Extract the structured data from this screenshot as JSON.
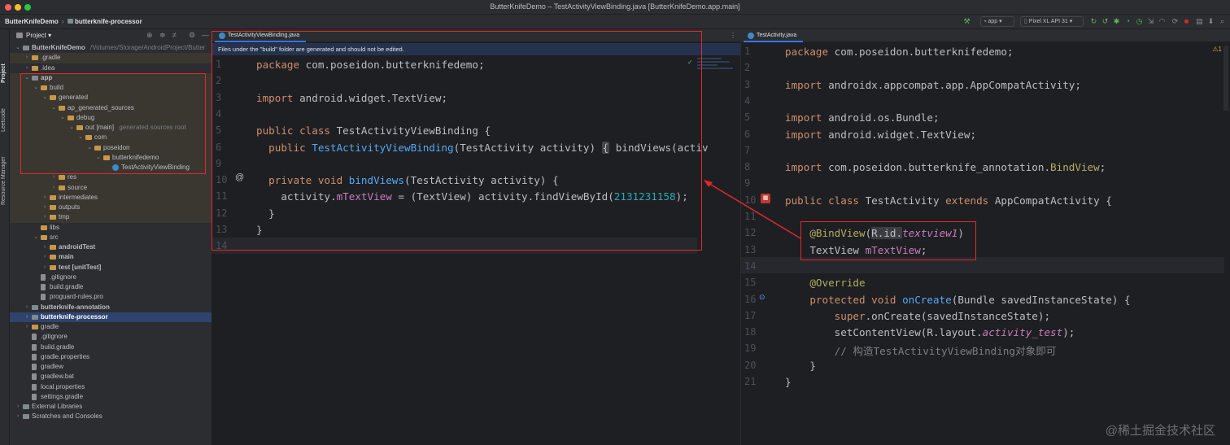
{
  "window": {
    "title": "ButterKnifeDemo – TestActivityViewBinding.java [ButterKnifeDemo.app.main]"
  },
  "navbar": {
    "project": "ButterKnifeDemo",
    "module": "butterknife-processor",
    "run_config": "app",
    "device": "Pixel XL API 31"
  },
  "toolstrip": {
    "items": [
      "Project",
      "Leetcode",
      "Resource Manager"
    ]
  },
  "project_panel": {
    "title": "Project",
    "tree": [
      {
        "label": "ButterKnifeDemo",
        "suffix": "/Volumes/Storage/AndroidProject/Butter",
        "depth": 0,
        "arrow": "down",
        "icon": "folder-dark",
        "bold": true
      },
      {
        "label": ".gradle",
        "depth": 1,
        "arrow": "right",
        "icon": "folder",
        "gen": true
      },
      {
        "label": ".idea",
        "depth": 1,
        "arrow": "right",
        "icon": "folder"
      },
      {
        "label": "app",
        "depth": 1,
        "arrow": "down",
        "icon": "folder-dark",
        "bold": true,
        "gen": true
      },
      {
        "label": "build",
        "depth": 2,
        "arrow": "down",
        "icon": "folder",
        "gen": true
      },
      {
        "label": "generated",
        "depth": 3,
        "arrow": "down",
        "icon": "folder",
        "gen": true
      },
      {
        "label": "ap_generated_sources",
        "depth": 4,
        "arrow": "down",
        "icon": "folder",
        "gen": true
      },
      {
        "label": "debug",
        "depth": 5,
        "arrow": "down",
        "icon": "folder",
        "gen": true
      },
      {
        "label": "out [main]",
        "suffix": "generated sources root",
        "depth": 6,
        "arrow": "down",
        "icon": "folder",
        "gen": true
      },
      {
        "label": "com",
        "depth": 7,
        "arrow": "down",
        "icon": "folder",
        "gen": true
      },
      {
        "label": "poseidon",
        "depth": 8,
        "arrow": "down",
        "icon": "folder",
        "gen": true
      },
      {
        "label": "butterknifedemo",
        "depth": 9,
        "arrow": "down",
        "icon": "folder",
        "gen": true
      },
      {
        "label": "TestActivityViewBinding",
        "depth": 10,
        "arrow": "",
        "icon": "class",
        "gen": true
      },
      {
        "label": "res",
        "depth": 4,
        "arrow": "right",
        "icon": "folder",
        "gen": true
      },
      {
        "label": "source",
        "depth": 4,
        "arrow": "right",
        "icon": "folder",
        "gen": true
      },
      {
        "label": "intermediates",
        "depth": 3,
        "arrow": "right",
        "icon": "folder",
        "gen": true
      },
      {
        "label": "outputs",
        "depth": 3,
        "arrow": "right",
        "icon": "folder",
        "gen": true
      },
      {
        "label": "tmp",
        "depth": 3,
        "arrow": "right",
        "icon": "folder",
        "gen": true
      },
      {
        "label": "libs",
        "depth": 2,
        "arrow": "",
        "icon": "folder"
      },
      {
        "label": "src",
        "depth": 2,
        "arrow": "down",
        "icon": "folder"
      },
      {
        "label": "androidTest",
        "depth": 3,
        "arrow": "right",
        "icon": "folder",
        "bold": true
      },
      {
        "label": "main",
        "depth": 3,
        "arrow": "right",
        "icon": "folder",
        "bold": true
      },
      {
        "label": "test [unitTest]",
        "depth": 3,
        "arrow": "right",
        "icon": "folder",
        "bold": true
      },
      {
        "label": ".gitignore",
        "depth": 2,
        "arrow": "",
        "icon": "file"
      },
      {
        "label": "build.gradle",
        "depth": 2,
        "arrow": "",
        "icon": "file"
      },
      {
        "label": "proguard-rules.pro",
        "depth": 2,
        "arrow": "",
        "icon": "file"
      },
      {
        "label": "butterknife-annotation",
        "depth": 1,
        "arrow": "right",
        "icon": "folder-dark",
        "bold": true
      },
      {
        "label": "butterknife-processor",
        "depth": 1,
        "arrow": "right",
        "icon": "folder-dark",
        "bold": true,
        "sel": true
      },
      {
        "label": "gradle",
        "depth": 1,
        "arrow": "right",
        "icon": "folder"
      },
      {
        "label": ".gitignore",
        "depth": 1,
        "arrow": "",
        "icon": "file"
      },
      {
        "label": "build.gradle",
        "depth": 1,
        "arrow": "",
        "icon": "file"
      },
      {
        "label": "gradle.properties",
        "depth": 1,
        "arrow": "",
        "icon": "file"
      },
      {
        "label": "gradlew",
        "depth": 1,
        "arrow": "",
        "icon": "file"
      },
      {
        "label": "gradlew.bat",
        "depth": 1,
        "arrow": "",
        "icon": "file"
      },
      {
        "label": "local.properties",
        "depth": 1,
        "arrow": "",
        "icon": "file"
      },
      {
        "label": "settings.gradle",
        "depth": 1,
        "arrow": "",
        "icon": "file"
      },
      {
        "label": "External Libraries",
        "depth": 0,
        "arrow": "right",
        "icon": "folder-dark"
      },
      {
        "label": "Scratches and Consoles",
        "depth": 0,
        "arrow": "right",
        "icon": "folder-dark"
      }
    ]
  },
  "left_editor": {
    "tab": "TestActivityViewBinding.java",
    "banner": "Files under the \"build\" folder are generated and should not be edited.",
    "lines": [
      [
        {
          "t": "package ",
          "c": "kw"
        },
        {
          "t": "com.poseidon.butterknifedemo;",
          "c": "ty"
        }
      ],
      [],
      [
        {
          "t": "import ",
          "c": "kw"
        },
        {
          "t": "android.widget.TextView;",
          "c": "ty"
        }
      ],
      [],
      [
        {
          "t": "public class ",
          "c": "kw"
        },
        {
          "t": "TestActivityViewBinding {",
          "c": "ty"
        }
      ],
      [
        {
          "t": "  public ",
          "c": "kw"
        },
        {
          "t": "TestActivityViewBinding",
          "c": "fn"
        },
        {
          "t": "(TestActivity activity) ",
          "c": "ty"
        },
        {
          "t": "{",
          "c": "fold"
        },
        {
          "t": " bindViews(activ",
          "c": "ty"
        }
      ],
      [],
      [
        {
          "t": "  private void ",
          "c": "kw"
        },
        {
          "t": "bindViews",
          "c": "fn"
        },
        {
          "t": "(TestActivity activity) {",
          "c": "ty"
        }
      ],
      [
        {
          "t": "    activity.",
          "c": "ty"
        },
        {
          "t": "mTextView",
          "c": "fld"
        },
        {
          "t": " = (TextView) activity.findViewById(",
          "c": "ty"
        },
        {
          "t": "2131231158",
          "c": "num"
        },
        {
          "t": ");",
          "c": "ty"
        }
      ],
      [
        {
          "t": "  }",
          "c": "ty"
        }
      ],
      [
        {
          "t": "}",
          "c": "ty"
        }
      ],
      []
    ],
    "line_numbers": [
      "1",
      "2",
      "3",
      "4",
      "5",
      "6",
      "9",
      "10",
      "11",
      "12",
      "13",
      "14"
    ]
  },
  "right_editor": {
    "tab": "TestActivity.java",
    "warning_count": "1",
    "lines": [
      [
        {
          "t": "package ",
          "c": "kw"
        },
        {
          "t": "com.poseidon.butterknifedemo;",
          "c": "ty"
        }
      ],
      [],
      [
        {
          "t": "import ",
          "c": "kw"
        },
        {
          "t": "androidx.appcompat.app.AppCompatActivity;",
          "c": "ty"
        }
      ],
      [],
      [
        {
          "t": "import ",
          "c": "kw"
        },
        {
          "t": "android.os.Bundle;",
          "c": "ty"
        }
      ],
      [
        {
          "t": "import ",
          "c": "kw"
        },
        {
          "t": "android.widget.TextView;",
          "c": "ty"
        }
      ],
      [],
      [
        {
          "t": "import ",
          "c": "kw"
        },
        {
          "t": "com.poseidon.butterknife_annotation.",
          "c": "ty"
        },
        {
          "t": "BindView",
          "c": "ann"
        },
        {
          "t": ";",
          "c": "ty"
        }
      ],
      [],
      [
        {
          "t": "public class ",
          "c": "kw"
        },
        {
          "t": "TestActivity ",
          "c": "ty"
        },
        {
          "t": "extends ",
          "c": "kw"
        },
        {
          "t": "AppCompatActivity {",
          "c": "ty"
        }
      ],
      [],
      [
        {
          "t": "    @BindView",
          "c": "ann"
        },
        {
          "t": "(",
          "c": "ty"
        },
        {
          "t": "R.id.",
          "c": "hl"
        },
        {
          "t": "textview1",
          "c": "ital"
        },
        {
          "t": ")",
          "c": "ty"
        }
      ],
      [
        {
          "t": "    TextView ",
          "c": "ty"
        },
        {
          "t": "mTextView",
          "c": "fld"
        },
        {
          "t": ";",
          "c": "ty"
        }
      ],
      [],
      [
        {
          "t": "    @Override",
          "c": "ann"
        }
      ],
      [
        {
          "t": "    protected void ",
          "c": "kw"
        },
        {
          "t": "onCreate",
          "c": "fn"
        },
        {
          "t": "(Bundle savedInstanceState) {",
          "c": "ty"
        }
      ],
      [
        {
          "t": "        super",
          "c": "kw"
        },
        {
          "t": ".onCreate(savedInstanceState);",
          "c": "ty"
        }
      ],
      [
        {
          "t": "        setContentView(R.layout.",
          "c": "ty"
        },
        {
          "t": "activity_test",
          "c": "ital"
        },
        {
          "t": ");",
          "c": "ty"
        }
      ],
      [
        {
          "t": "        // 构造TestActivityViewBinding对象即可",
          "c": "cmt"
        }
      ],
      [
        {
          "t": "    }",
          "c": "ty"
        }
      ],
      [
        {
          "t": "}",
          "c": "ty"
        }
      ]
    ],
    "line_numbers": [
      "1",
      "2",
      "3",
      "4",
      "5",
      "6",
      "7",
      "8",
      "9",
      "10",
      "11",
      "12",
      "13",
      "14",
      "15",
      "16",
      "17",
      "18",
      "19",
      "20",
      "21"
    ]
  },
  "watermark": "@稀土掘金技术社区",
  "colors": {
    "keyword": "#cf8e6d",
    "function": "#56a8f5",
    "field": "#c77dbb",
    "number": "#2aacb8",
    "annotation": "#b3ae60",
    "highlight_box": "#e0282e",
    "selection": "#2e436e"
  }
}
